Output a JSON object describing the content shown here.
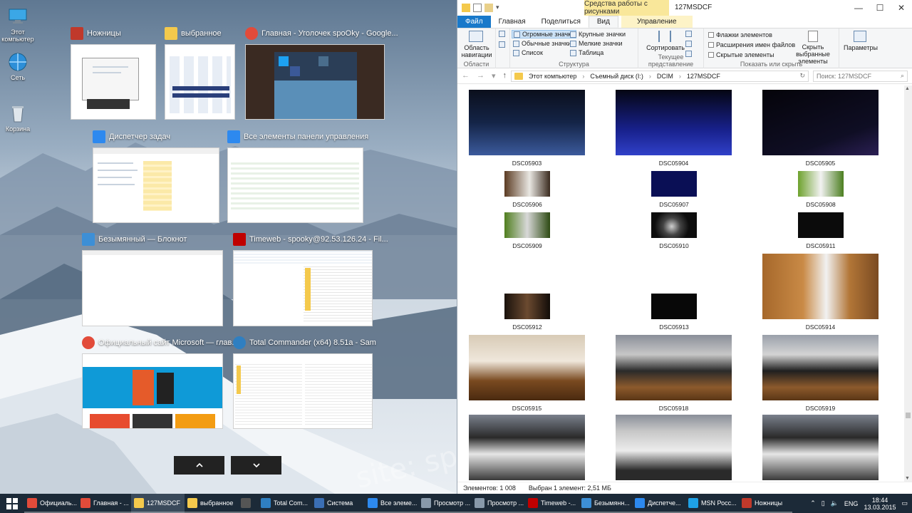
{
  "desktop": {
    "icons": [
      {
        "label": "Этот компьютер",
        "icon": "this-pc-icon"
      },
      {
        "label": "Сеть",
        "icon": "network-icon"
      },
      {
        "label": "Корзина",
        "icon": "recycle-bin-icon"
      }
    ],
    "watermark": "site: spoOky.ru"
  },
  "snap": {
    "windows": [
      {
        "title": "Ножницы",
        "icon": "scissors-icon",
        "color": "#c0392b"
      },
      {
        "title": "выбранное",
        "icon": "folder-icon",
        "color": "#f4c94c"
      },
      {
        "title": "Главная - Уголочек spoOky - Google...",
        "icon": "chrome-icon",
        "color": "#e24b3a"
      },
      {
        "title": "Диспетчер задач",
        "icon": "task-manager-icon",
        "color": "#2d89ef"
      },
      {
        "title": "Все элементы панели управления",
        "icon": "control-panel-icon",
        "color": "#2d89ef"
      },
      {
        "title": "Безымянный — Блокнот",
        "icon": "notepad-icon",
        "color": "#3d8fd6"
      },
      {
        "title": "Timeweb - spooky@92.53.126.24 - Fil...",
        "icon": "filezilla-icon",
        "color": "#bf0000"
      },
      {
        "title": "Официальный сайт Microsoft — глав...",
        "icon": "chrome-icon",
        "color": "#e24b3a"
      },
      {
        "title": "Total Commander (x64) 8.51a - Sam",
        "icon": "total-commander-icon",
        "color": "#2f7fc1"
      }
    ],
    "up_icon": "chevron-up-icon",
    "down_icon": "chevron-down-icon"
  },
  "explorer": {
    "context_tab": "Средства работы с рисунками",
    "window_title": "127MSDCF",
    "tabs": [
      "Файл",
      "Главная",
      "Поделиться",
      "Вид",
      "Управление"
    ],
    "ribbon": {
      "nav_pane": "Область навигации",
      "group_areas": "Области",
      "layout": [
        "Огромные значки",
        "Крупные значки",
        "Обычные значки",
        "Мелкие значки",
        "Список",
        "Таблица"
      ],
      "group_structure": "Структура",
      "sort": "Сортировать",
      "group_view": "Текущее представление",
      "checks": [
        "Флажки элементов",
        "Расширения имен файлов",
        "Скрытые элементы"
      ],
      "hide_selected": "Скрыть выбранные элементы",
      "group_show": "Показать или скрыть",
      "options": "Параметры"
    },
    "address": [
      "Этот компьютер",
      "Съемный диск (I:)",
      "DCIM",
      "127MSDCF"
    ],
    "search_placeholder": "Поиск: 127MSDCF",
    "files": [
      "DSC05903",
      "DSC05904",
      "DSC05905",
      "DSC05906",
      "DSC05907",
      "DSC05908",
      "DSC05909",
      "DSC05910",
      "DSC05911",
      "DSC05912",
      "DSC05913",
      "DSC05914",
      "DSC05915",
      "DSC05918",
      "DSC05919"
    ],
    "status_count": "Элементов: 1 008",
    "status_selected": "Выбран 1 элемент: 2,51 МБ"
  },
  "taskbar": {
    "items": [
      {
        "label": "Официаль...",
        "icon": "chrome-icon",
        "color": "#e24b3a"
      },
      {
        "label": "Главная - ...",
        "icon": "chrome-icon",
        "color": "#e24b3a"
      },
      {
        "label": "127MSDCF",
        "icon": "folder-icon",
        "color": "#f4c94c"
      },
      {
        "label": "выбранное",
        "icon": "folder-icon",
        "color": "#f4c94c"
      },
      {
        "label": "",
        "icon": "store-icon",
        "color": "#555555"
      },
      {
        "label": "Total Com...",
        "icon": "total-commander-icon",
        "color": "#2f7fc1"
      },
      {
        "label": "Система",
        "icon": "system-icon",
        "color": "#3b6fb5"
      },
      {
        "label": "Все элеме...",
        "icon": "control-panel-icon",
        "color": "#2d89ef"
      },
      {
        "label": "Просмотр ...",
        "icon": "photo-viewer-icon",
        "color": "#8899aa"
      },
      {
        "label": "Просмотр ...",
        "icon": "photo-viewer-icon",
        "color": "#8899aa"
      },
      {
        "label": "Timeweb -...",
        "icon": "filezilla-icon",
        "color": "#bf0000"
      },
      {
        "label": "Безымянн...",
        "icon": "notepad-icon",
        "color": "#3d8fd6"
      },
      {
        "label": "Диспетче...",
        "icon": "task-manager-icon",
        "color": "#2d89ef"
      },
      {
        "label": "MSN Росс...",
        "icon": "ie-icon",
        "color": "#1ea1e6"
      },
      {
        "label": "Ножницы",
        "icon": "scissors-icon",
        "color": "#c0392b"
      }
    ],
    "lang": "ENG",
    "time": "18:44",
    "date": "13.03.2015"
  }
}
